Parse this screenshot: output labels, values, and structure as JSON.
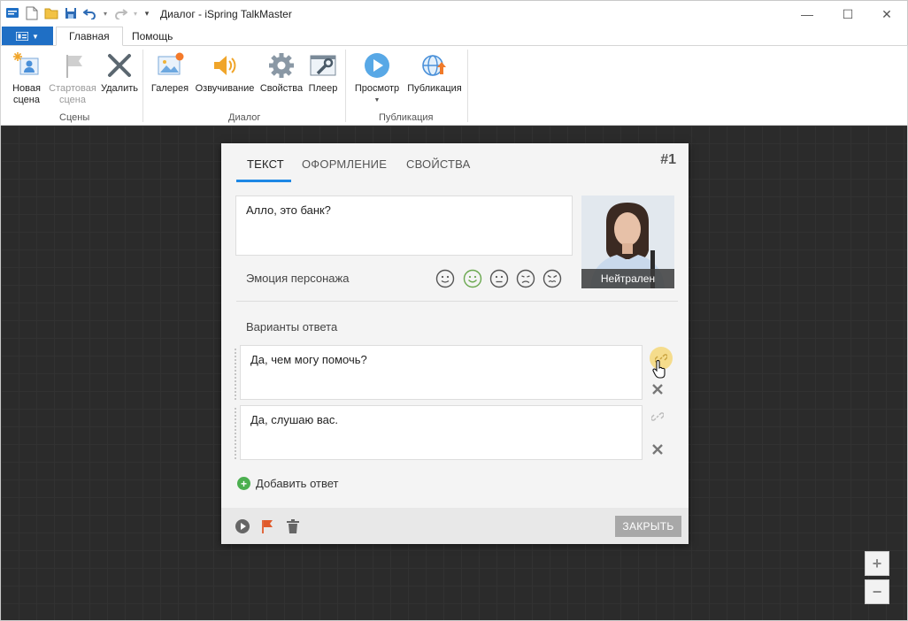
{
  "window": {
    "title": "Диалог - iSpring TalkMaster",
    "controls": {
      "minimize": "—",
      "maximize": "☐",
      "close": "✕"
    }
  },
  "ribbon_tabs": {
    "home": "Главная",
    "help": "Помощь"
  },
  "ribbon": {
    "scenes_group": "Сцены",
    "dialog_group": "Диалог",
    "publish_group": "Публикация",
    "new_scene": [
      "Новая",
      "сцена"
    ],
    "start_scene": [
      "Стартовая",
      "сцена"
    ],
    "delete": "Удалить",
    "gallery": "Галерея",
    "voiceover": "Озвучивание",
    "properties": "Свойства",
    "player": "Плеер",
    "preview": "Просмотр",
    "publish": "Публикация"
  },
  "panel": {
    "tabs": {
      "text": "ТЕКСТ",
      "design": "ОФОРМЛЕНИЕ",
      "properties": "СВОЙСТВА"
    },
    "scene_number": "#1",
    "phrase": "Алло, это банк?",
    "emotion_label": "Эмоция персонажа",
    "emotions": [
      "neutral",
      "smile",
      "doubt",
      "sad",
      "angry"
    ],
    "selected_emotion": "smile",
    "character_state": "Нейтрален",
    "answers_label": "Варианты ответа",
    "answers": [
      "Да, чем могу помочь?",
      "Да, слушаю вас."
    ],
    "add_answer": "Добавить ответ",
    "close_button": "ЗАКРЫТЬ"
  },
  "zoom": {
    "in": "+",
    "out": "−"
  },
  "colors": {
    "accent": "#1e88e5",
    "file_button": "#1f6fc5",
    "add_green": "#4caf50",
    "flag": "#e05a2b"
  }
}
